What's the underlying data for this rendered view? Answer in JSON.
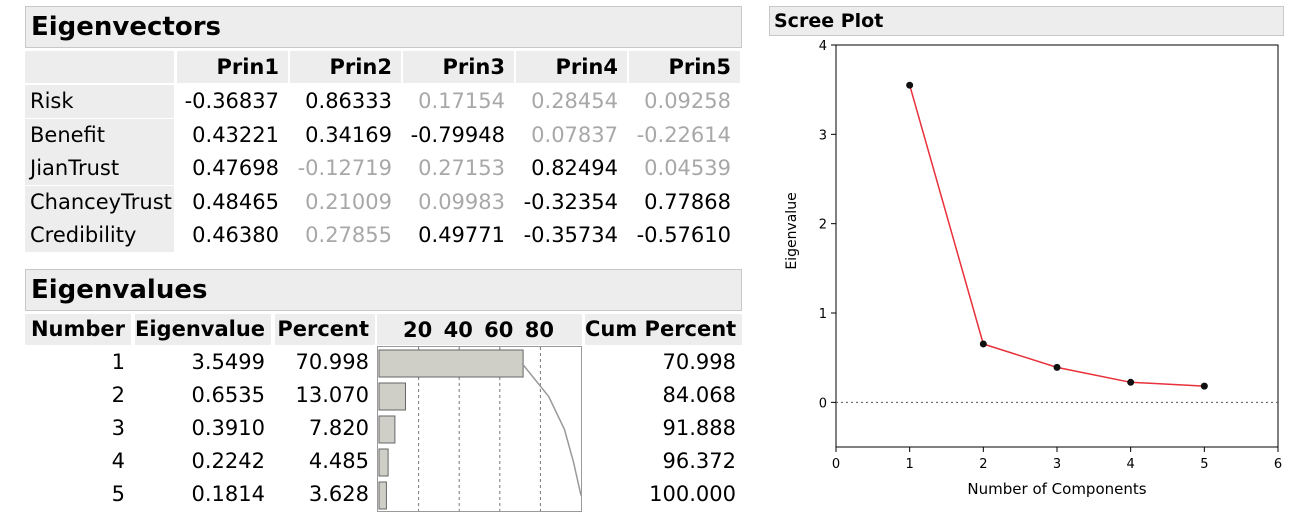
{
  "eigenvectors": {
    "title": "Eigenvectors",
    "columns": [
      "Prin1",
      "Prin2",
      "Prin3",
      "Prin4",
      "Prin5"
    ],
    "rows": [
      {
        "label": "Risk",
        "values": [
          "-0.36837",
          "0.86333",
          "0.17154",
          "0.28454",
          "0.09258"
        ],
        "dim": [
          false,
          false,
          true,
          true,
          true
        ]
      },
      {
        "label": "Benefit",
        "values": [
          "0.43221",
          "0.34169",
          "-0.79948",
          "0.07837",
          "-0.22614"
        ],
        "dim": [
          false,
          false,
          false,
          true,
          true
        ]
      },
      {
        "label": "JianTrust",
        "values": [
          "0.47698",
          "-0.12719",
          "0.27153",
          "0.82494",
          "0.04539"
        ],
        "dim": [
          false,
          true,
          true,
          false,
          true
        ]
      },
      {
        "label": "ChanceyTrust",
        "values": [
          "0.48465",
          "0.21009",
          "0.09983",
          "-0.32354",
          "0.77868"
        ],
        "dim": [
          false,
          true,
          true,
          false,
          false
        ]
      },
      {
        "label": "Credibility",
        "values": [
          "0.46380",
          "0.27855",
          "0.49771",
          "-0.35734",
          "-0.57610"
        ],
        "dim": [
          false,
          true,
          false,
          false,
          false
        ]
      }
    ],
    "dim_color": "#a8a8a8"
  },
  "eigenvalues": {
    "title": "Eigenvalues",
    "headers": {
      "number": "Number",
      "eigenvalue": "Eigenvalue",
      "percent": "Percent",
      "bar_ticks": [
        "20",
        "40",
        "60",
        "80"
      ],
      "cum": "Cum Percent"
    },
    "rows": [
      {
        "number": "1",
        "eigenvalue": "3.5499",
        "percent": "70.998",
        "cum": "70.998",
        "percent_value": 70.998,
        "cum_value": 70.998
      },
      {
        "number": "2",
        "eigenvalue": "0.6535",
        "percent": "13.070",
        "cum": "84.068",
        "percent_value": 13.07,
        "cum_value": 84.068
      },
      {
        "number": "3",
        "eigenvalue": "0.3910",
        "percent": "7.820",
        "cum": "91.888",
        "percent_value": 7.82,
        "cum_value": 91.888
      },
      {
        "number": "4",
        "eigenvalue": "0.2242",
        "percent": "4.485",
        "cum": "96.372",
        "percent_value": 4.485,
        "cum_value": 96.372
      },
      {
        "number": "5",
        "eigenvalue": "0.1814",
        "percent": "3.628",
        "cum": "100.000",
        "percent_value": 3.628,
        "cum_value": 100.0
      }
    ],
    "bar_color": "#cfcfc8"
  },
  "chart_data": {
    "type": "line",
    "title": "Scree Plot",
    "xlabel": "Number of Components",
    "ylabel": "Eigenvalue",
    "x": [
      1,
      2,
      3,
      4,
      5
    ],
    "values": [
      3.5499,
      0.6535,
      0.391,
      0.2242,
      0.1814
    ],
    "xlim": [
      0,
      6
    ],
    "ylim": [
      -0.5,
      4
    ],
    "x_ticks": [
      "0",
      "1",
      "2",
      "3",
      "4",
      "5",
      "6"
    ],
    "y_ticks": [
      "0",
      "1",
      "2",
      "3",
      "4"
    ],
    "reference_line_y": 0,
    "grid": false,
    "line_color": "#e8303a",
    "point_color": "#111111"
  }
}
